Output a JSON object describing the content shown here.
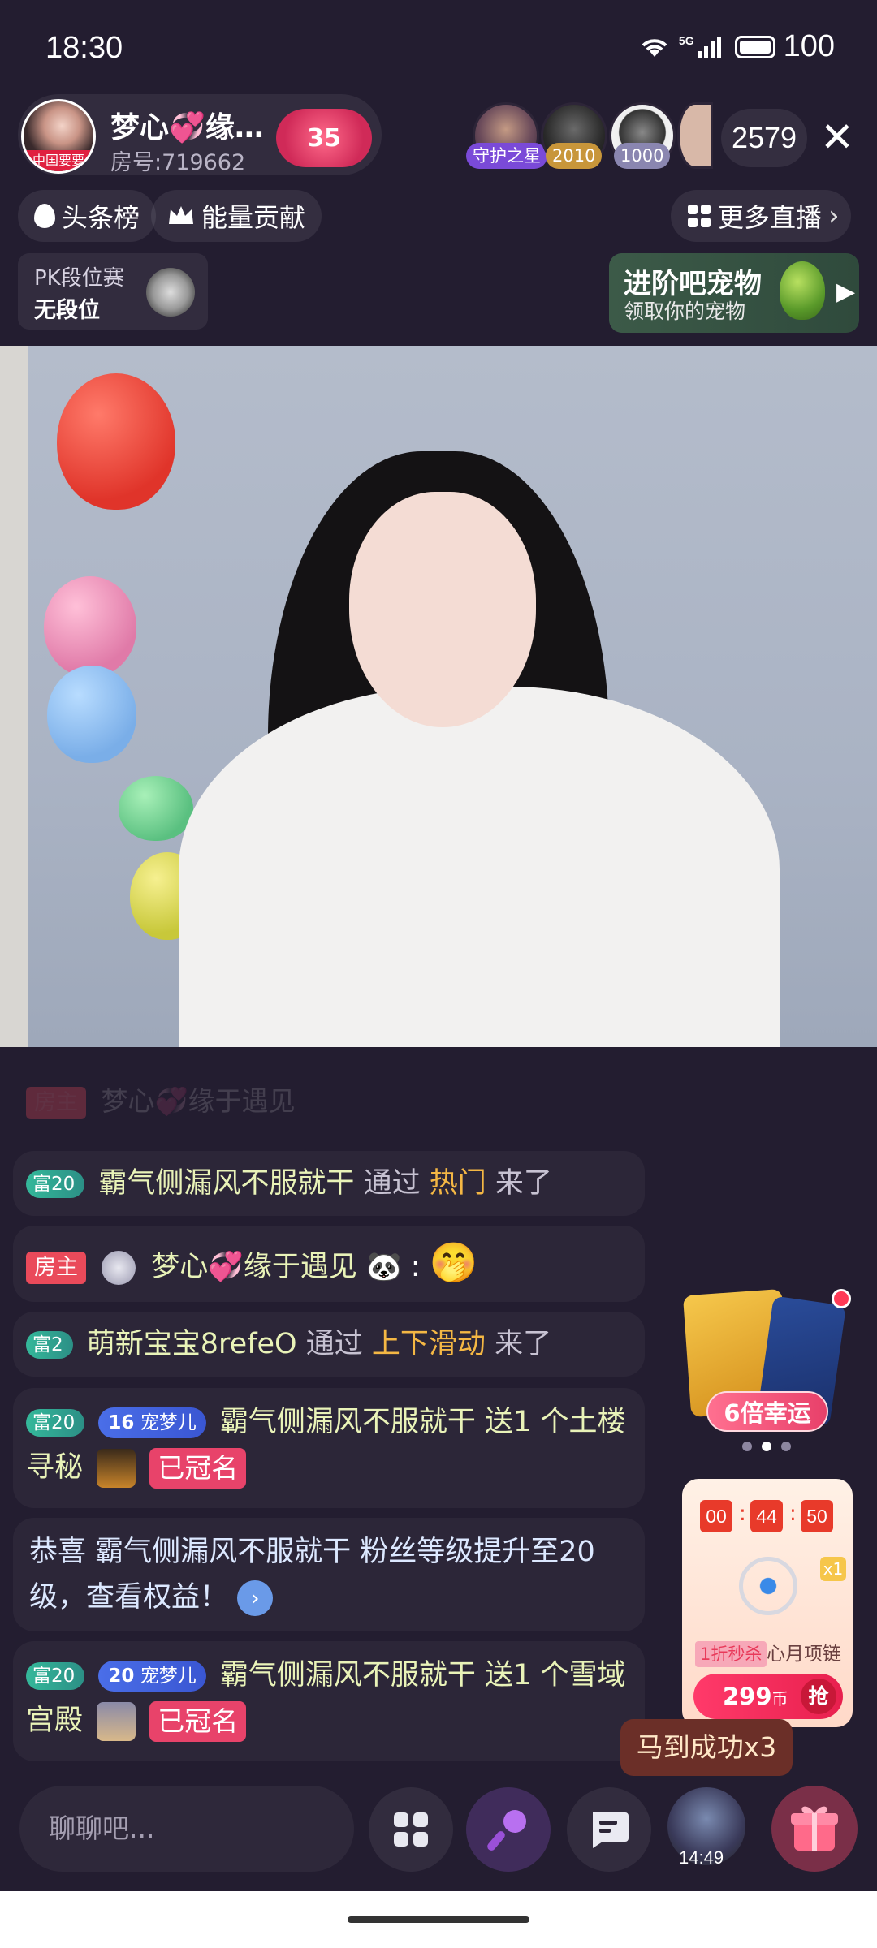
{
  "status": {
    "time": "18:30",
    "network": "5G",
    "battery": "100"
  },
  "header": {
    "host_name": "梦心💞缘…",
    "room_id": "房号:719662",
    "host_avatar_tag": "中国要要",
    "level": "35",
    "viewers": [
      {
        "badge": "守护之星"
      },
      {
        "badge": "2010"
      },
      {
        "badge": "1000"
      }
    ],
    "viewer_count": "2579"
  },
  "pills": {
    "headline": "头条榜",
    "energy": "能量贡献",
    "more": "更多直播"
  },
  "pk": {
    "title": "PK段位赛",
    "value": "无段位"
  },
  "promo": {
    "title": "进阶吧宠物",
    "subtitle": "领取你的宠物"
  },
  "chat": [
    {
      "rich": "富20",
      "user": "霸气侧漏风不服就干",
      "via": "通过",
      "source": "热门",
      "tail": "来了"
    },
    {
      "host_tag": "房主",
      "user": "梦心💞缘于遇见",
      "emoji": "🐼",
      "sep": ":",
      "face": "🤭"
    },
    {
      "rich": "富2",
      "user": "萌新宝宝8refeO",
      "via": "通过",
      "source": "上下滑动",
      "tail": "来了"
    },
    {
      "rich": "富20",
      "fan_level": "16",
      "fan_name": "宠梦儿",
      "user": "霸气侧漏风不服就干",
      "action": "送1",
      "gift": "个土楼寻秘",
      "crown": "已冠名"
    },
    {
      "text": "恭喜 霸气侧漏风不服就干 粉丝等级提升至20级，查看权益！",
      "arrow": "›"
    },
    {
      "rich": "富20",
      "fan_level": "20",
      "fan_name": "宠梦儿",
      "user": "霸气侧漏风不服就干",
      "action": "送1",
      "gift": "个雪域宫殿",
      "crown": "已冠名"
    }
  ],
  "faded_line": {
    "tag": "房主",
    "user": "梦心💞缘于遇见"
  },
  "widgets": {
    "lucky": "6倍幸运",
    "timer": [
      "00",
      "44",
      "50"
    ],
    "flash_tag": "1折秒杀",
    "flash_name": "心月项链",
    "price": "299",
    "price_unit": "币",
    "grab": "抢",
    "multiplier": "x1",
    "toast": "马到成功x3"
  },
  "bottom": {
    "input_placeholder": "聊聊吧...",
    "avatar_time": "14:49"
  },
  "colors": {
    "background": "#231d30",
    "rich_badge": "#34b89a",
    "host_badge": "#ea4a5a",
    "crown": "#e8436a",
    "source_highlight": "#f4b744"
  }
}
